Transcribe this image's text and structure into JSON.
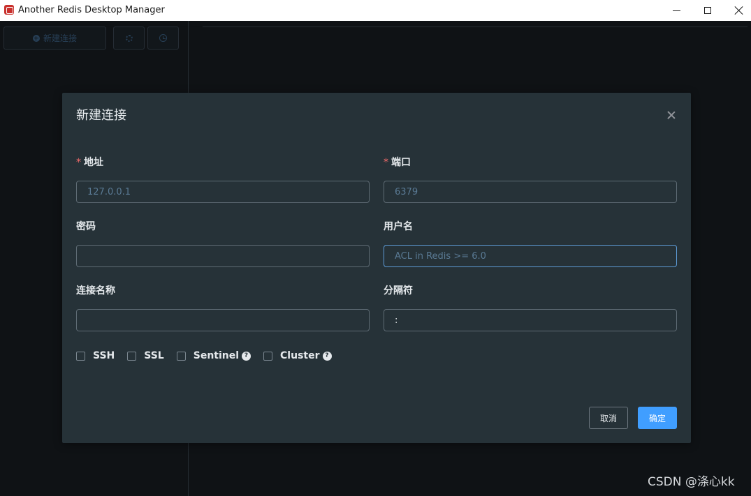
{
  "window": {
    "title": "Another Redis Desktop Manager"
  },
  "sidebar": {
    "new_connection_label": "新建连接"
  },
  "dialog": {
    "title": "新建连接",
    "fields": {
      "host": {
        "label": "地址",
        "placeholder": "127.0.0.1",
        "value": ""
      },
      "port": {
        "label": "端口",
        "placeholder": "6379",
        "value": ""
      },
      "password": {
        "label": "密码",
        "placeholder": "",
        "value": ""
      },
      "username": {
        "label": "用户名",
        "placeholder": "ACL in Redis >= 6.0",
        "value": ""
      },
      "connection_name": {
        "label": "连接名称",
        "placeholder": "",
        "value": ""
      },
      "separator": {
        "label": "分隔符",
        "placeholder": "",
        "value": ":"
      }
    },
    "required_marker": "*",
    "options": [
      {
        "label": "SSH",
        "checked": false,
        "help": false
      },
      {
        "label": "SSL",
        "checked": false,
        "help": false
      },
      {
        "label": "Sentinel",
        "checked": false,
        "help": true
      },
      {
        "label": "Cluster",
        "checked": false,
        "help": true
      }
    ],
    "help_glyph": "?",
    "cancel_label": "取消",
    "ok_label": "确定"
  },
  "watermark": "CSDN @涤心kk",
  "colors": {
    "background": "#171c21",
    "dialog": "#263238",
    "primary": "#409eff",
    "required": "#f56c6c"
  }
}
